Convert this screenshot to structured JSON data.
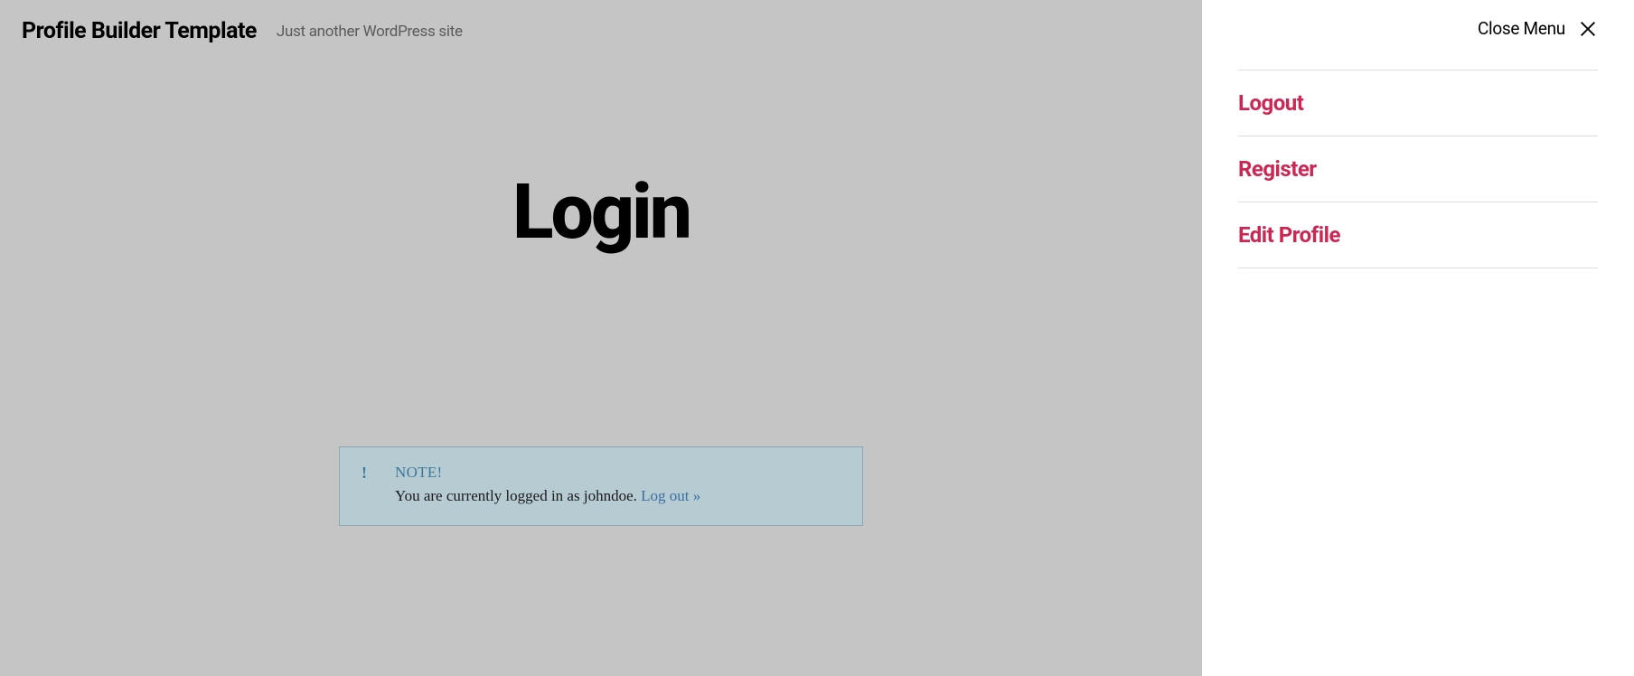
{
  "header": {
    "title": "Profile Builder Template",
    "tagline": "Just another WordPress site"
  },
  "page": {
    "title": "Login"
  },
  "note": {
    "label": "NOTE!",
    "text": "You are currently logged in as johndoe. ",
    "link": "Log out »"
  },
  "sideMenu": {
    "closeLabel": "Close Menu",
    "items": [
      {
        "label": "Logout"
      },
      {
        "label": "Register"
      },
      {
        "label": "Edit Profile"
      }
    ]
  }
}
